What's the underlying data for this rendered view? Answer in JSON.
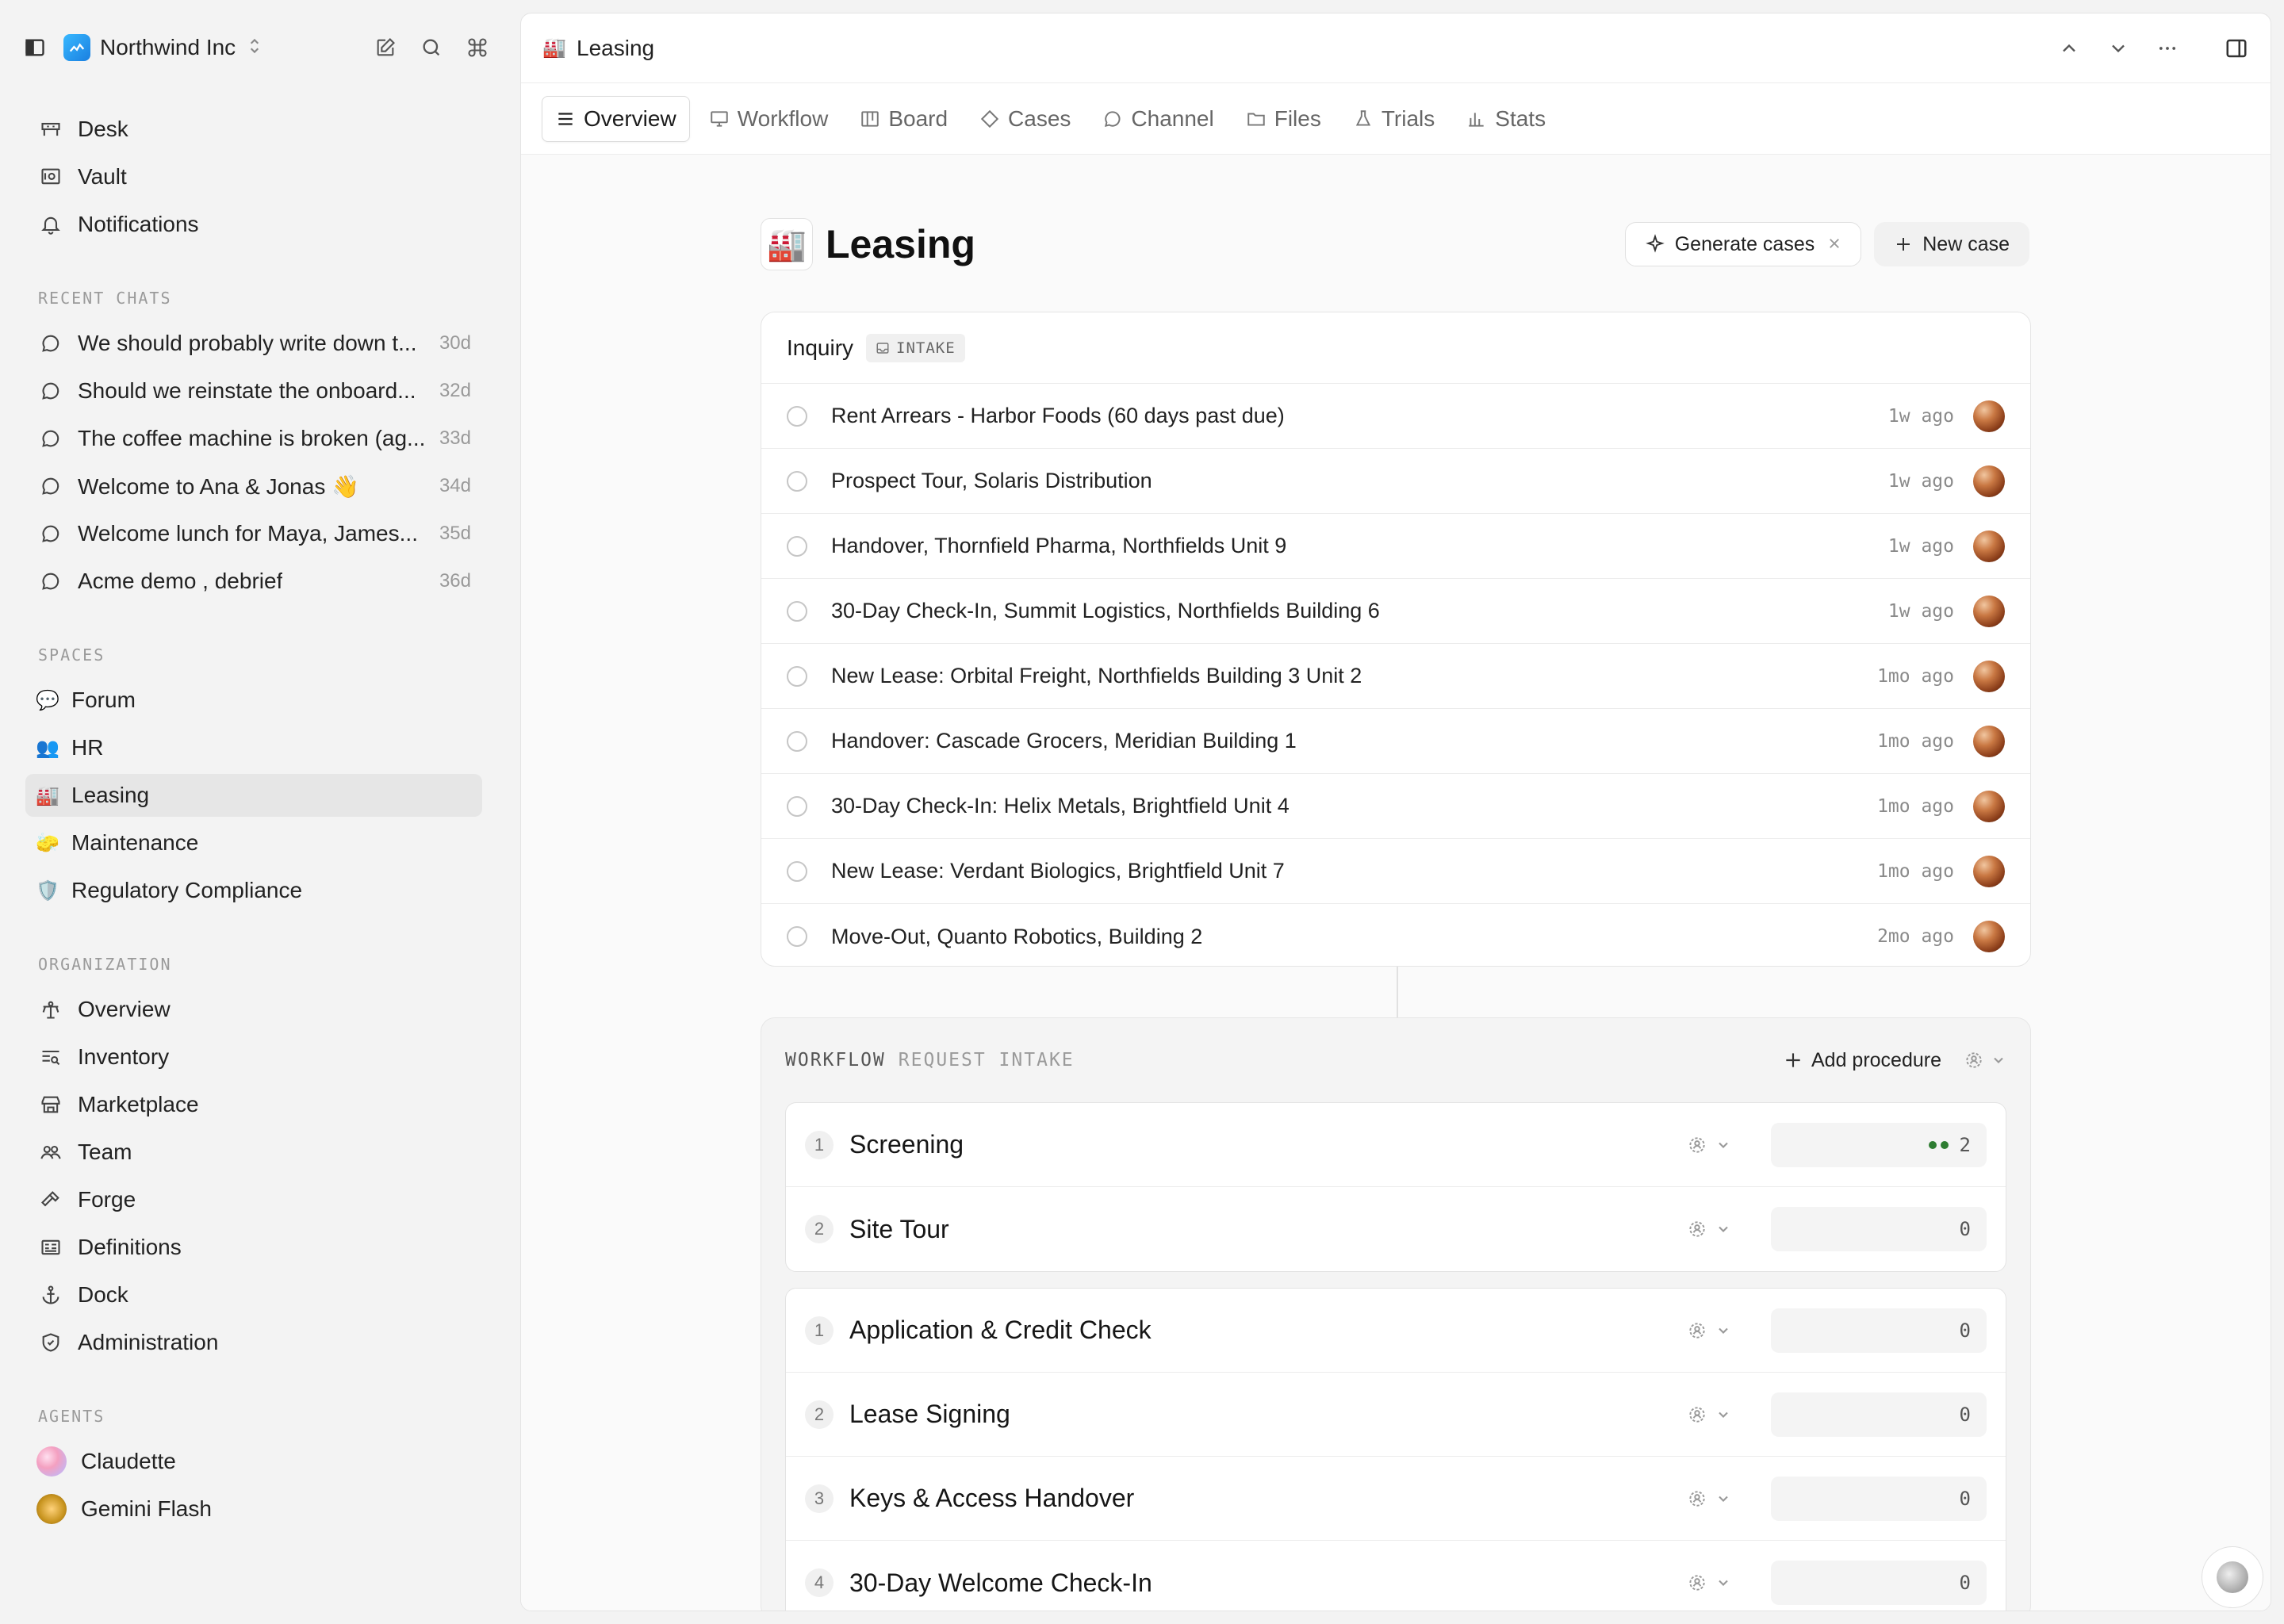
{
  "workspace": {
    "name": "Northwind Inc",
    "brand_color": "#1a9cf0"
  },
  "sidebar": {
    "primary": [
      {
        "label": "Desk",
        "icon": "desk-icon"
      },
      {
        "label": "Vault",
        "icon": "vault-icon"
      },
      {
        "label": "Notifications",
        "icon": "bell-icon"
      }
    ],
    "recent_chats_title": "RECENT CHATS",
    "recent_chats": [
      {
        "label": "We should probably write down t...",
        "age": "30d"
      },
      {
        "label": "Should we reinstate the onboard...",
        "age": "32d"
      },
      {
        "label": "The coffee machine is broken (ag...",
        "age": "33d"
      },
      {
        "label": "Welcome to Ana & Jonas 👋",
        "age": "34d"
      },
      {
        "label": "Welcome lunch for Maya, James...",
        "age": "35d"
      },
      {
        "label": "Acme demo , debrief",
        "age": "36d"
      }
    ],
    "spaces_title": "SPACES",
    "spaces": [
      {
        "label": "Forum",
        "emoji": "💬"
      },
      {
        "label": "HR",
        "emoji": "👥"
      },
      {
        "label": "Leasing",
        "emoji": "🏭",
        "active": true
      },
      {
        "label": "Maintenance",
        "emoji": "🧽"
      },
      {
        "label": "Regulatory Compliance",
        "emoji": "🛡️"
      }
    ],
    "organization_title": "ORGANIZATION",
    "organization": [
      {
        "label": "Overview",
        "icon": "overview-icon"
      },
      {
        "label": "Inventory",
        "icon": "inventory-icon"
      },
      {
        "label": "Marketplace",
        "icon": "store-icon"
      },
      {
        "label": "Team",
        "icon": "team-icon"
      },
      {
        "label": "Forge",
        "icon": "hammer-icon"
      },
      {
        "label": "Definitions",
        "icon": "definitions-icon"
      },
      {
        "label": "Dock",
        "icon": "anchor-icon"
      },
      {
        "label": "Administration",
        "icon": "shield-icon"
      }
    ],
    "agents_title": "AGENTS",
    "agents": [
      {
        "label": "Claudette"
      },
      {
        "label": "Gemini Flash"
      }
    ]
  },
  "header": {
    "title": "Leasing",
    "emoji": "🏭"
  },
  "tabs": [
    {
      "label": "Overview",
      "icon": "menu-icon",
      "active": true
    },
    {
      "label": "Workflow",
      "icon": "monitor-icon"
    },
    {
      "label": "Board",
      "icon": "board-icon"
    },
    {
      "label": "Cases",
      "icon": "diamond-icon"
    },
    {
      "label": "Channel",
      "icon": "chat-bubble-icon"
    },
    {
      "label": "Files",
      "icon": "folder-icon"
    },
    {
      "label": "Trials",
      "icon": "flask-icon"
    },
    {
      "label": "Stats",
      "icon": "bar-chart-icon"
    }
  ],
  "page": {
    "title": "Leasing",
    "emoji": "🏭",
    "generate_label": "Generate cases",
    "new_case_label": "New case"
  },
  "inquiry": {
    "title": "Inquiry",
    "badge": "INTAKE",
    "rows": [
      {
        "name": "Rent Arrears - Harbor Foods (60 days past due)",
        "age": "1w ago"
      },
      {
        "name": "Prospect Tour, Solaris Distribution",
        "age": "1w ago"
      },
      {
        "name": "Handover, Thornfield Pharma, Northfields Unit 9",
        "age": "1w ago"
      },
      {
        "name": "30-Day Check-In, Summit Logistics, Northfields Building 6",
        "age": "1w ago"
      },
      {
        "name": "New Lease: Orbital Freight, Northfields Building 3 Unit 2",
        "age": "1mo ago"
      },
      {
        "name": "Handover: Cascade Grocers, Meridian Building 1",
        "age": "1mo ago"
      },
      {
        "name": "30-Day Check-In: Helix Metals, Brightfield Unit 4",
        "age": "1mo ago"
      },
      {
        "name": "New Lease: Verdant Biologics, Brightfield Unit 7",
        "age": "1mo ago"
      },
      {
        "name": "Move-Out, Quanto Robotics, Building 2",
        "age": "2mo ago"
      }
    ]
  },
  "workflow": {
    "label": "WORKFLOW",
    "sub": "REQUEST INTAKE",
    "add_label": "Add procedure",
    "groups": [
      [
        {
          "num": "1",
          "name": "Screening",
          "count": "2",
          "dots": 2
        },
        {
          "num": "2",
          "name": "Site Tour",
          "count": "0",
          "dots": 0
        }
      ],
      [
        {
          "num": "1",
          "name": "Application & Credit Check",
          "count": "0",
          "dots": 0
        },
        {
          "num": "2",
          "name": "Lease Signing",
          "count": "0",
          "dots": 0
        },
        {
          "num": "3",
          "name": "Keys & Access Handover",
          "count": "0",
          "dots": 0
        },
        {
          "num": "4",
          "name": "30-Day Welcome Check-In",
          "count": "0",
          "dots": 0
        }
      ]
    ]
  }
}
